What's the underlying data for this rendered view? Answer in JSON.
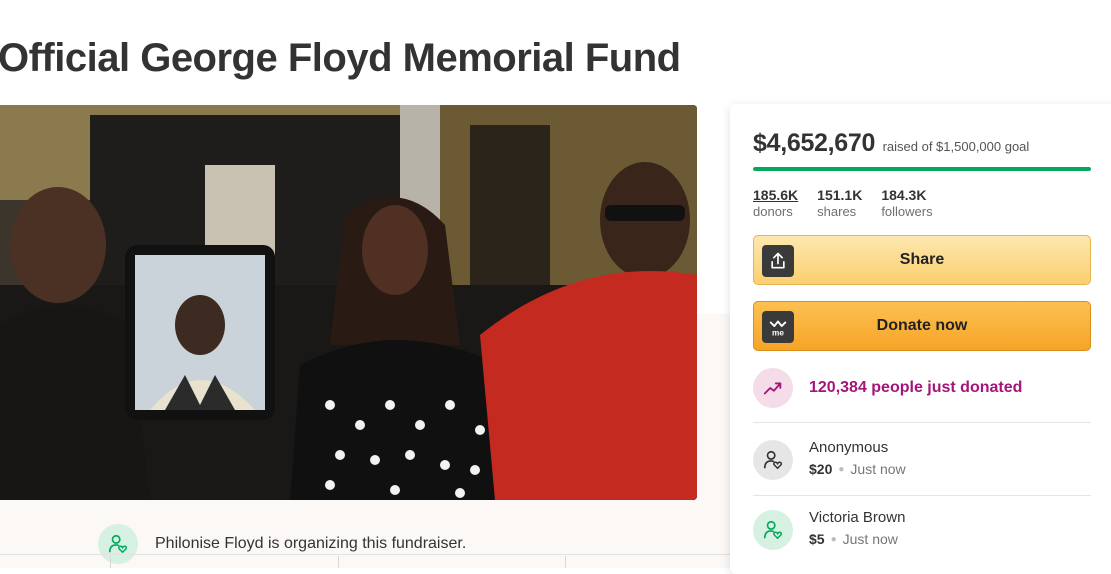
{
  "campaign": {
    "title": "Official George Floyd Memorial Fund",
    "organizer_text": "Philonise Floyd is organizing this fundraiser."
  },
  "funding": {
    "raised_amount": "$4,652,670",
    "raised_of_text": "raised of $1,500,000 goal",
    "progress_fraction": 1.0,
    "progress_color": "#02a95c"
  },
  "stats": [
    {
      "value": "185.6K",
      "label": "donors"
    },
    {
      "value": "151.1K",
      "label": "shares"
    },
    {
      "value": "184.3K",
      "label": "followers"
    }
  ],
  "actions": {
    "share_label": "Share",
    "share_icon": "upload-share-icon",
    "donate_label": "Donate now",
    "donate_icon": "gofundme-logo-icon"
  },
  "activity": {
    "trend_text": "120,384 people just donated",
    "trend_icon": "trending-up-icon",
    "trend_color": "#a3157a"
  },
  "donations": [
    {
      "name": "Anonymous",
      "amount": "$20",
      "time": "Just now",
      "icon": "heart-person-icon",
      "avatar_bg": "#e6e6e6"
    },
    {
      "name": "Victoria Brown",
      "amount": "$5",
      "time": "Just now",
      "icon": "heart-person-icon",
      "avatar_bg": "#d6f0e2"
    }
  ]
}
